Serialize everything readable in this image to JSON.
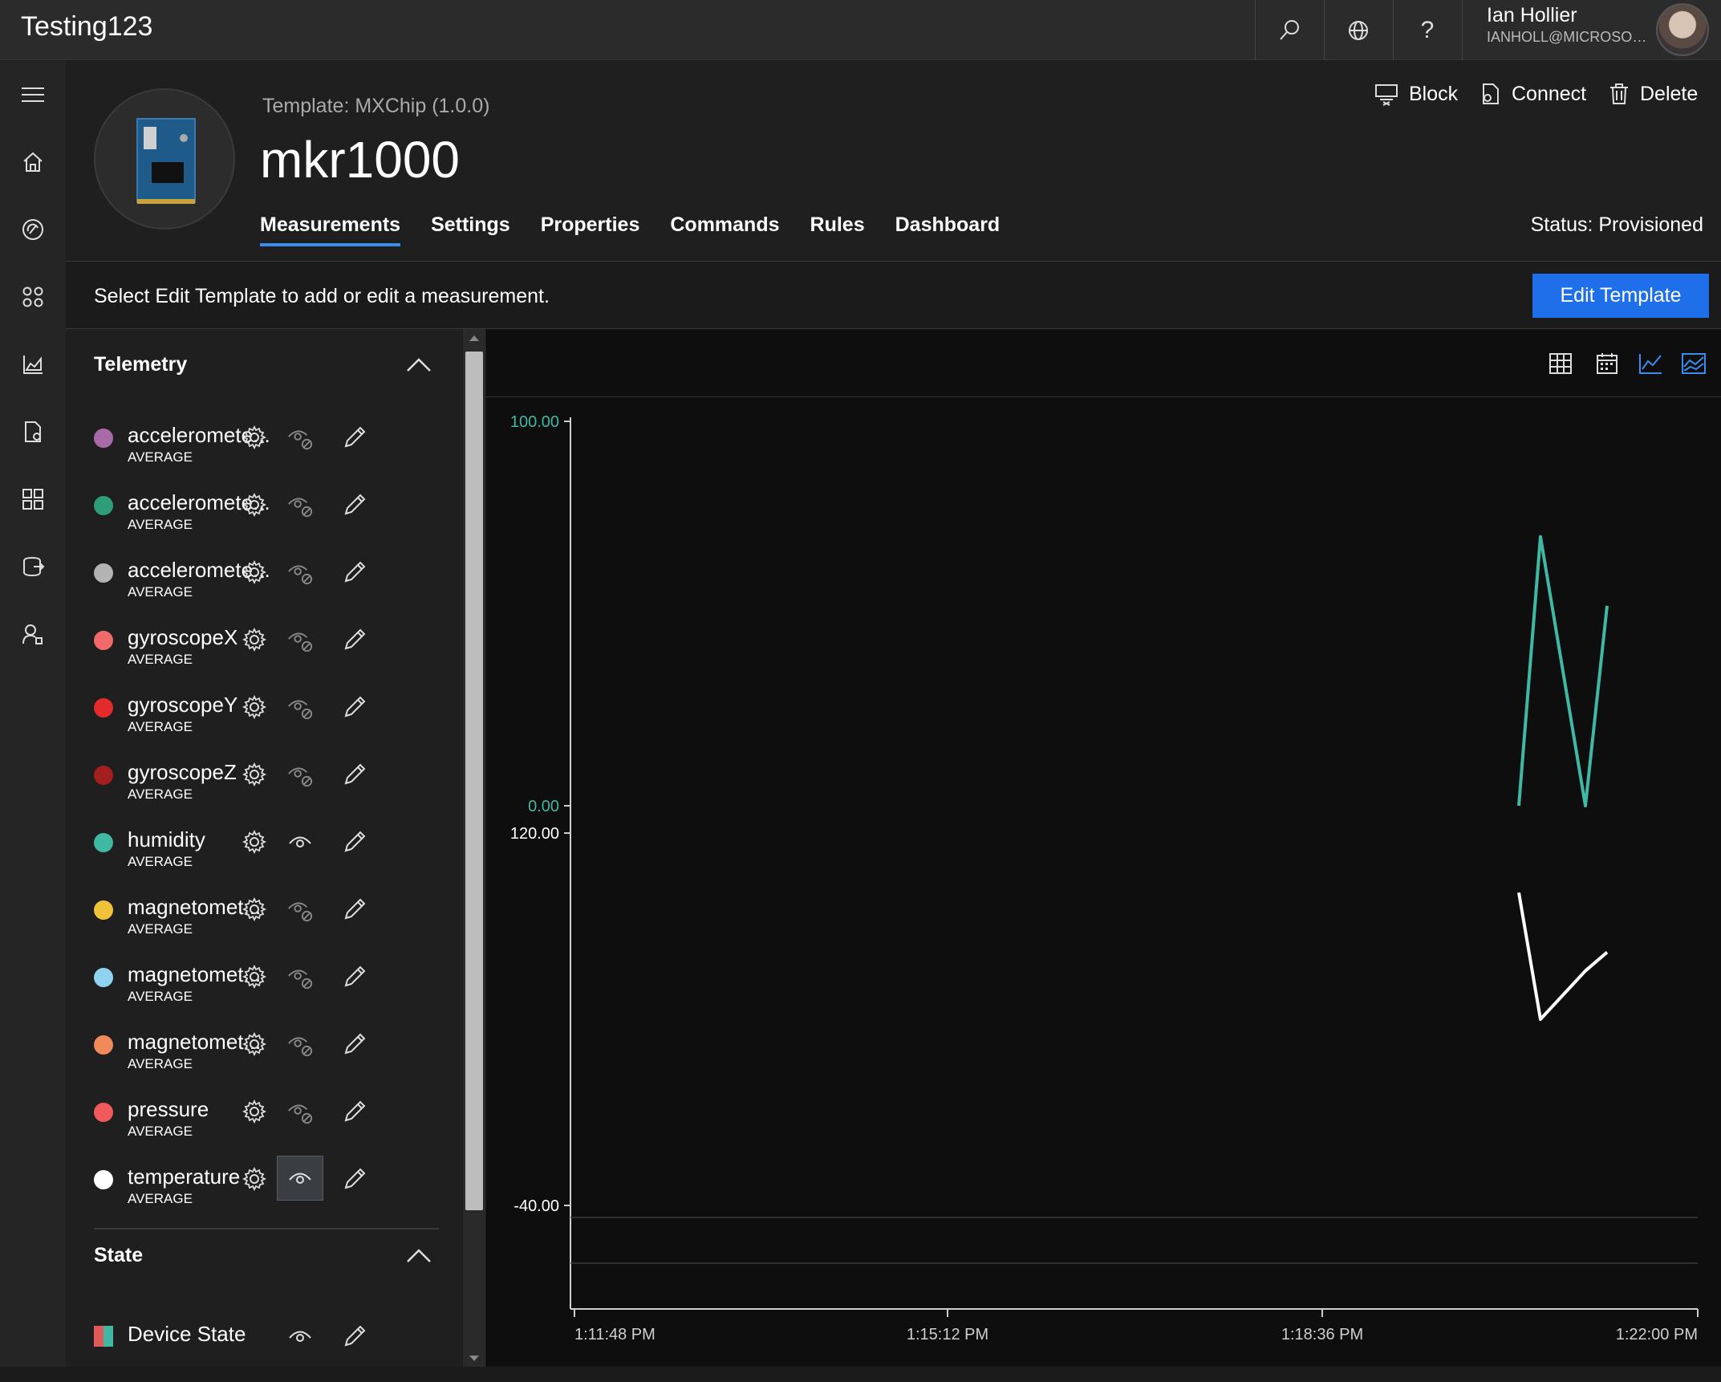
{
  "app": {
    "title": "Testing123"
  },
  "user": {
    "name": "Ian Hollier",
    "email": "IANHOLL@MICROSOF..."
  },
  "topbar": {
    "icons": [
      "search-icon",
      "globe-icon",
      "help-icon"
    ]
  },
  "device": {
    "template_label": "Template:  MXChip   (1.0.0)",
    "name": "mkr1000",
    "status": "Status: Provisioned"
  },
  "tabs": [
    "Measurements",
    "Settings",
    "Properties",
    "Commands",
    "Rules",
    "Dashboard"
  ],
  "actions": {
    "block": "Block",
    "connect": "Connect",
    "delete": "Delete"
  },
  "info": {
    "text": "Select Edit Template to add or edit a measurement.",
    "edit_button": "Edit Template"
  },
  "telemetry": {
    "title": "Telemetry",
    "items": [
      {
        "name": "acceleromete...",
        "sub": "AVERAGE",
        "color": "#a86aa8",
        "visible": false
      },
      {
        "name": "acceleromete...",
        "sub": "AVERAGE",
        "color": "#2e9e7a",
        "visible": false
      },
      {
        "name": "acceleromete...",
        "sub": "AVERAGE",
        "color": "#b3b3b3",
        "visible": false
      },
      {
        "name": "gyroscopeX",
        "sub": "AVERAGE",
        "color": "#f06a6a",
        "visible": false
      },
      {
        "name": "gyroscopeY",
        "sub": "AVERAGE",
        "color": "#e32b2b",
        "visible": false
      },
      {
        "name": "gyroscopeZ",
        "sub": "AVERAGE",
        "color": "#a31e1e",
        "visible": false
      },
      {
        "name": "humidity",
        "sub": "AVERAGE",
        "color": "#3fb8a4",
        "visible": true
      },
      {
        "name": "magnetomet...",
        "sub": "AVERAGE",
        "color": "#f0c23a",
        "visible": false
      },
      {
        "name": "magnetomet...",
        "sub": "AVERAGE",
        "color": "#8fd3ef",
        "visible": false
      },
      {
        "name": "magnetomet...",
        "sub": "AVERAGE",
        "color": "#f08a5a",
        "visible": false
      },
      {
        "name": "pressure",
        "sub": "AVERAGE",
        "color": "#f05a5a",
        "visible": false
      },
      {
        "name": "temperature",
        "sub": "AVERAGE",
        "color": "#ffffff",
        "visible": true
      }
    ]
  },
  "state": {
    "title": "State",
    "items": [
      {
        "name": "Device State"
      }
    ]
  },
  "chart_toolbar": {
    "icons": [
      "grid-icon",
      "calendar-icon",
      "line-chart-icon",
      "area-chart-icon"
    ]
  },
  "chart_data": {
    "type": "line",
    "x_ticks": [
      "1:11:48 PM",
      "1:15:12 PM",
      "1:18:36 PM",
      "1:22:00 PM"
    ],
    "series": [
      {
        "axis_ticks": [
          "100.00",
          "0.00"
        ],
        "color": "#3fb8a4",
        "values": [
          0,
          70,
          0,
          52
        ]
      },
      {
        "axis_ticks": [
          "120.00",
          "-40.00"
        ],
        "color": "#ffffff",
        "values": [
          84,
          50,
          63,
          68
        ]
      }
    ]
  }
}
